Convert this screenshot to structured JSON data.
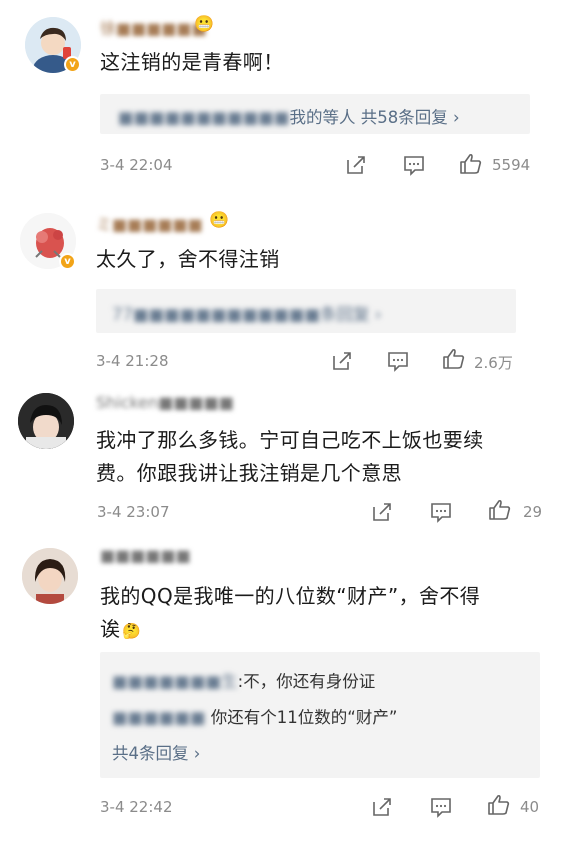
{
  "comments": [
    {
      "username": "徐■■■■■■",
      "text_lines": [
        "这注销的是青春啊！"
      ],
      "reply_preview": {
        "names": "■■■■■■■■■■■",
        "suffix": "我的等人",
        "count": "共58条回复 ›"
      },
      "time": "3-4 22:04",
      "likes": "5594"
    },
    {
      "username": "ミ■■■■■■",
      "text_lines": [
        "太久了，舍不得注销"
      ],
      "reply_preview": {
        "names": "77■■■■■■■■■■■■",
        "count": "条回复 ›"
      },
      "time": "3-4 21:28",
      "likes": "2.6万"
    },
    {
      "username": "Shicken■■■■■",
      "text_lines": [
        "我冲了那么多钱。宁可自己吃不上饭也要续",
        "费。你跟我讲让我注销是几个意思"
      ],
      "time": "3-4 23:07",
      "likes": "29"
    },
    {
      "username": "■■■■■■",
      "text_lines": [
        "我的QQ是我唯一的八位数“财产”，舍不得",
        "诶"
      ],
      "replies": [
        {
          "name": "■■■■■■■生",
          "text": ":不，你还有身份证"
        },
        {
          "name": "■■■■■■",
          "text": "你还有个11位数的“财产”"
        }
      ],
      "reply_count": "共4条回复 ›",
      "time": "3-4 22:42",
      "likes": "40"
    }
  ],
  "icons": [
    "share-icon",
    "comment-icon",
    "like-icon",
    "emoji-grimace",
    "emoji-think"
  ],
  "colors": {
    "username": "#a77d57",
    "link": "#5a6f87",
    "meta": "#8b8b8b",
    "reply_bg": "#f3f3f3",
    "verified": "#f2a418"
  }
}
